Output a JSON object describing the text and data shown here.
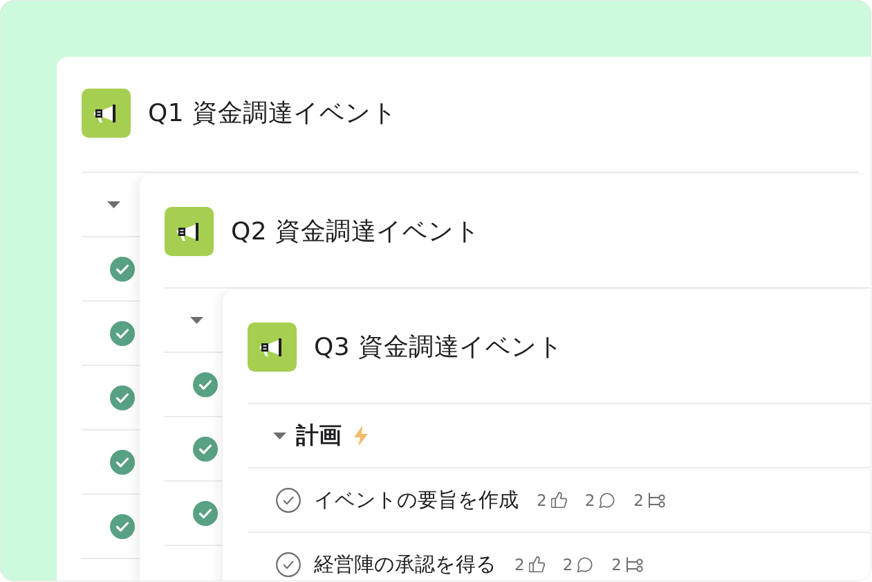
{
  "projects": [
    {
      "title": "Q1 資金調達イベント",
      "section": {
        "expanded": true,
        "tasks": [
          {
            "completed": true
          },
          {
            "completed": true
          },
          {
            "completed": true
          },
          {
            "completed": true
          },
          {
            "completed": true
          }
        ]
      }
    },
    {
      "title": "Q2 資金調達イベント",
      "section": {
        "expanded": true,
        "tasks": [
          {
            "completed": true
          },
          {
            "completed": true
          },
          {
            "completed": true
          }
        ]
      }
    },
    {
      "title": "Q3 資金調達イベント",
      "section": {
        "name": "計画",
        "expanded": true,
        "tasks": [
          {
            "name": "イベントの要旨を作成",
            "completed": false,
            "likes": "2",
            "comments": "2",
            "subtasks": "2"
          },
          {
            "name": "経営陣の承認を得る",
            "completed": false,
            "likes": "2",
            "comments": "2",
            "subtasks": "2"
          }
        ]
      }
    }
  ]
}
